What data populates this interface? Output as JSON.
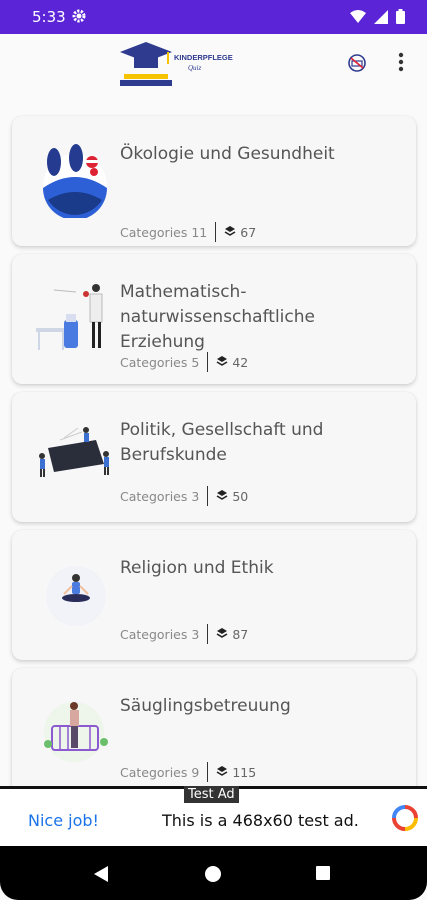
{
  "statusbar": {
    "time": "5:33",
    "accent": "#5b24d6"
  },
  "appbar": {
    "logo_text_line1": "KINDERPFLEGE",
    "logo_text_line2": "Quiz",
    "action_icon": "no-ads-icon",
    "menu_icon": "more-vert-icon"
  },
  "items": [
    {
      "title": "Ökologie und Gesundheit",
      "categories": "Categories 11",
      "count": "67"
    },
    {
      "title": "Mathematisch-naturwissenschaftliche Erziehung",
      "categories": "Categories 5",
      "count": "42"
    },
    {
      "title": "Politik, Gesellschaft und Berufskunde",
      "categories": "Categories 3",
      "count": "50"
    },
    {
      "title": "Religion und Ethik",
      "categories": "Categories 3",
      "count": "87"
    },
    {
      "title": "Säuglingsbetreuung",
      "categories": "Categories 9",
      "count": "115"
    }
  ],
  "ad": {
    "label": "Test Ad",
    "cta": "Nice job!",
    "text": "This is a 468x60 test ad."
  },
  "navbar": {
    "back_icon": "back-icon",
    "home_icon": "home-icon",
    "recents_icon": "recents-icon"
  }
}
